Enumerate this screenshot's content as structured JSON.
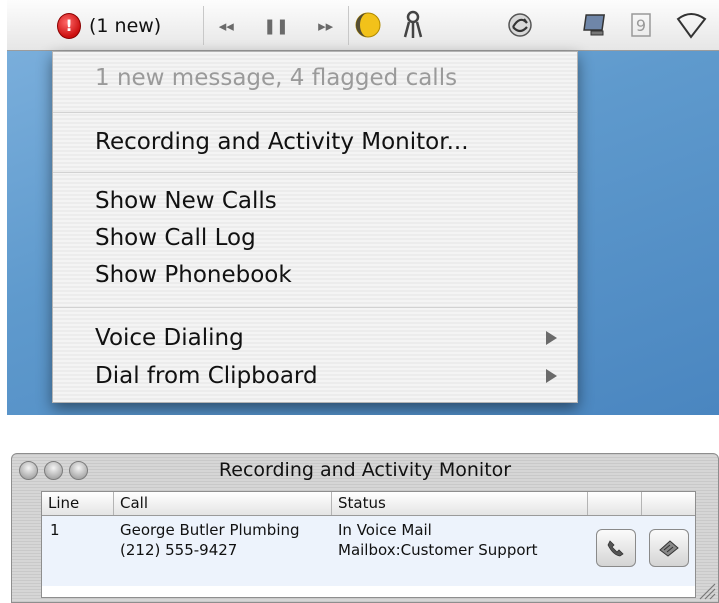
{
  "menubar": {
    "status_text": "(1 new)",
    "phone_glyph": "!",
    "transport": {
      "rewind": "◂◂",
      "pause": "❚❚",
      "forward": "▸▸"
    },
    "icons": [
      "phone-app-icon",
      "yellow-disc-icon",
      "keychain-icon",
      "sync-icon",
      "display-icon",
      "number-9-icon",
      "airport-icon"
    ]
  },
  "menu": {
    "status_line": "1 new message, 4 flagged calls",
    "recording_monitor": "Recording and Activity Monitor...",
    "show_new_calls": "Show New Calls",
    "show_call_log": "Show Call Log",
    "show_phonebook": "Show Phonebook",
    "voice_dialing": "Voice Dialing",
    "dial_from_clipboard": "Dial from Clipboard"
  },
  "window": {
    "title": "Recording and Activity Monitor",
    "columns": {
      "line": "Line",
      "call": "Call",
      "status": "Status"
    },
    "rows": [
      {
        "line": "1",
        "call_name": "George Butler Plumbing",
        "call_number": "(212) 555-9427",
        "status_main": "In Voice Mail",
        "status_detail": "Mailbox:Customer Support"
      }
    ]
  },
  "colors": {
    "desktop": "#5f9acd",
    "menu_disabled_text": "#9a9a9a",
    "row_highlight": "#edf3fc",
    "phone_icon_red": "#cc1010"
  }
}
